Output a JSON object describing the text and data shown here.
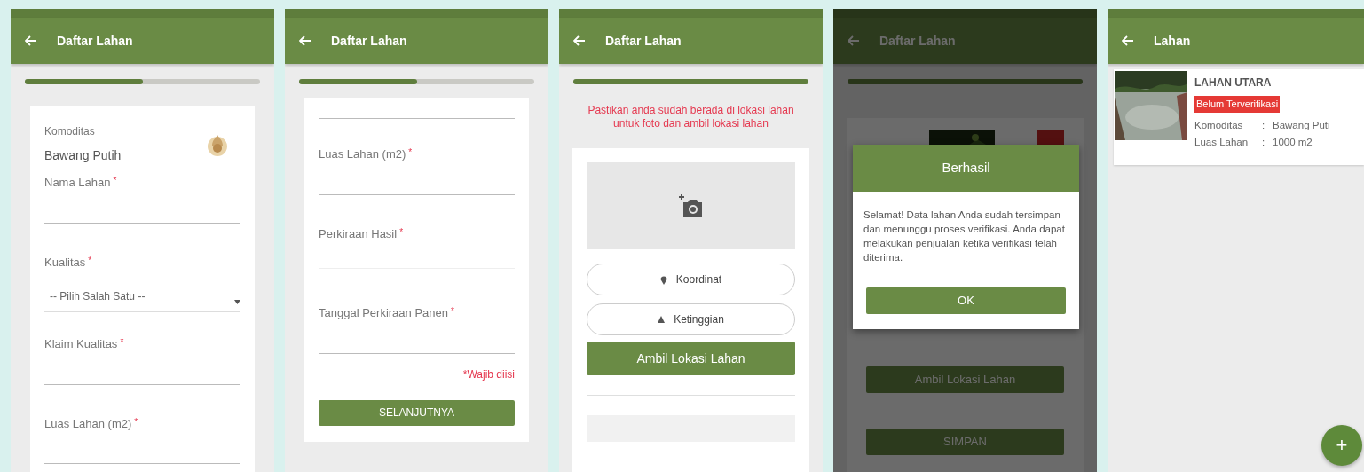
{
  "screens": [
    {
      "kind": "form_start",
      "title": "Daftar Lahan",
      "progress": {
        "level": 0.5
      },
      "commodity": {
        "label": "Komoditas",
        "value": "Bawang Putih"
      },
      "fields": [
        {
          "kind": "text",
          "label": "Nama Lahan",
          "required_mark": "*"
        },
        {
          "kind": "select",
          "label": "Kualitas",
          "required_mark": "*",
          "placeholder": "-- Pilih Salah Satu --"
        },
        {
          "kind": "text",
          "label": "Klaim Kualitas",
          "required_mark": "*"
        },
        {
          "kind": "text",
          "label": "Luas Lahan (m2)",
          "required_mark": "*"
        }
      ]
    },
    {
      "kind": "form_end",
      "title": "Daftar Lahan",
      "progress": {
        "level": 0.5
      },
      "fields": [
        {
          "kind": "cut"
        },
        {
          "kind": "text",
          "label": "Luas Lahan (m2)",
          "required_mark": "*"
        },
        {
          "kind": "plain",
          "label": "Perkiraan Hasil",
          "required_mark": "*"
        },
        {
          "kind": "text",
          "label": "Tanggal Perkiraan Panen",
          "required_mark": "*"
        }
      ],
      "note": "*Wajib diisi",
      "button": "SELANJUTNYA"
    },
    {
      "kind": "location",
      "title": "Daftar Lahan",
      "progress": {
        "level": 1
      },
      "warning": "Pastikan anda sudah berada di lokasi lahan untuk foto dan ambil lokasi lahan",
      "buttons": [
        {
          "kind": "coordinate",
          "label": "Koordinat"
        },
        {
          "kind": "altitude",
          "label": "Ketinggian"
        },
        {
          "kind": "primary",
          "label": "Ambil Lokasi Lahan"
        }
      ]
    },
    {
      "kind": "dialog",
      "title": "Daftar Lahan",
      "progress": {
        "level": 1
      },
      "behind_buttons": [
        "Ambil Lokasi Lahan",
        "SIMPAN"
      ],
      "dialog": {
        "title": "Berhasil",
        "message": "Selamat! Data lahan Anda sudah tersimpan dan menunggu proses verifikasi. Anda dapat melakukan penjualan ketika verifikasi telah diterima.",
        "button": "OK"
      }
    },
    {
      "kind": "list",
      "title": "Lahan",
      "items": [
        {
          "name": "LAHAN UTARA",
          "status": "Belum Terverifikasi",
          "details": [
            {
              "label": "Komoditas",
              "separator": ":",
              "value": "Bawang Puti"
            },
            {
              "label": "Luas Lahan",
              "separator": ":",
              "value": "1000 m2"
            }
          ]
        }
      ],
      "fab": "+"
    }
  ]
}
